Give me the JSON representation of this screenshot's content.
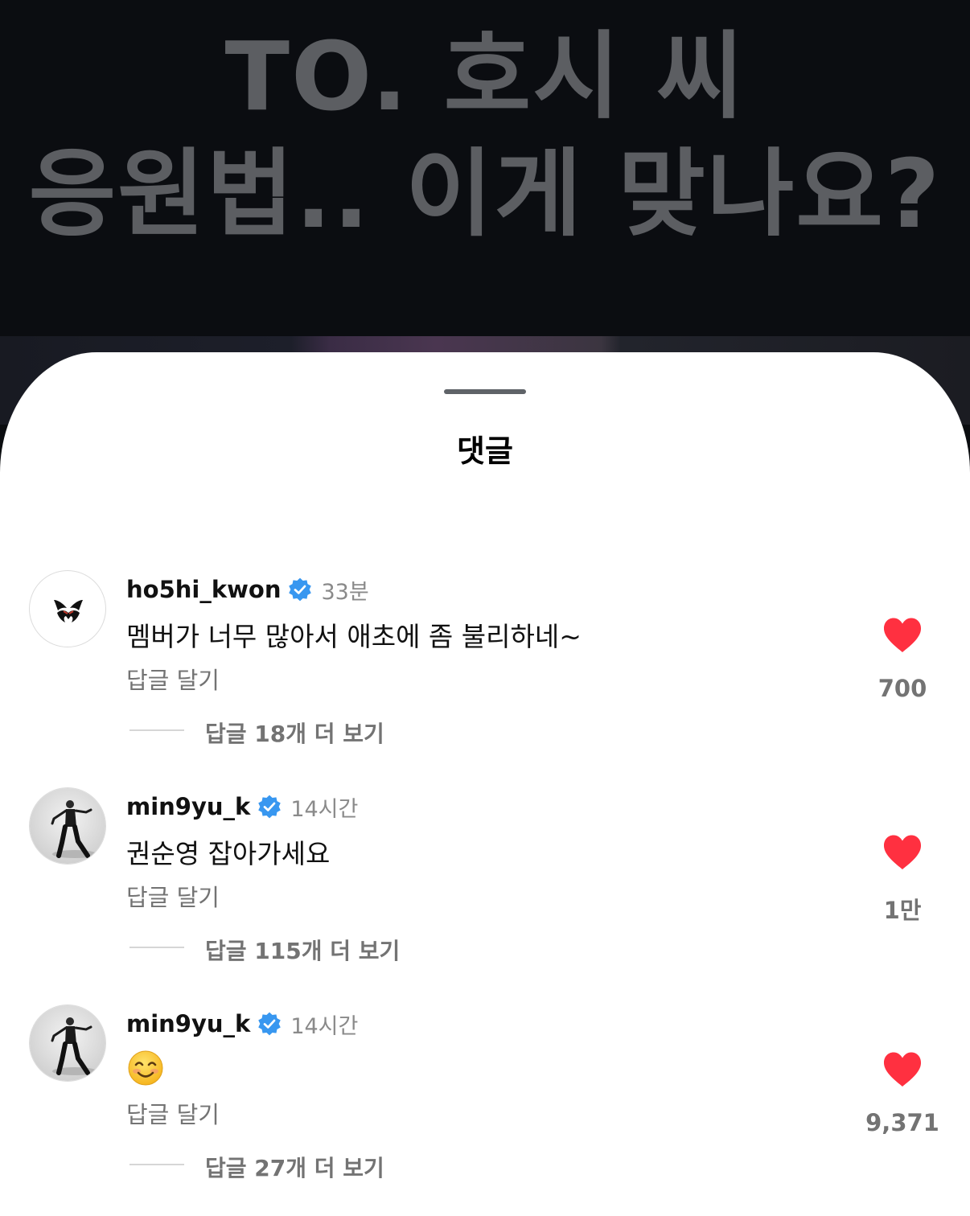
{
  "video": {
    "title_line1": "TO. 호시 씨",
    "title_line2": "응원법.. 이게 맞나요?"
  },
  "sheet": {
    "title": "댓글"
  },
  "comments": [
    {
      "username": "ho5hi_kwon",
      "verified": true,
      "time": "33분",
      "text": "멤버가 너무 많아서 애초에 좀 불리하네~",
      "reply_label": "답글 달기",
      "more_replies": "답글 18개 더 보기",
      "likes": "700",
      "liked": true
    },
    {
      "username": "min9yu_k",
      "verified": true,
      "time": "14시간",
      "text": "권순영 잡아가세요",
      "reply_label": "답글 달기",
      "more_replies": "답글 115개 더 보기",
      "likes": "1만",
      "liked": true
    },
    {
      "username": "min9yu_k",
      "verified": true,
      "time": "14시간",
      "text": "😊",
      "reply_label": "답글 달기",
      "more_replies": "답글 27개 더 보기",
      "likes": "9,371",
      "liked": true
    }
  ],
  "colors": {
    "like_red": "#ff3040",
    "verified_blue": "#3897f0",
    "secondary_text": "#737373"
  },
  "icons": [
    "heart-icon",
    "verified-badge-icon",
    "smiling-face-emoji"
  ]
}
